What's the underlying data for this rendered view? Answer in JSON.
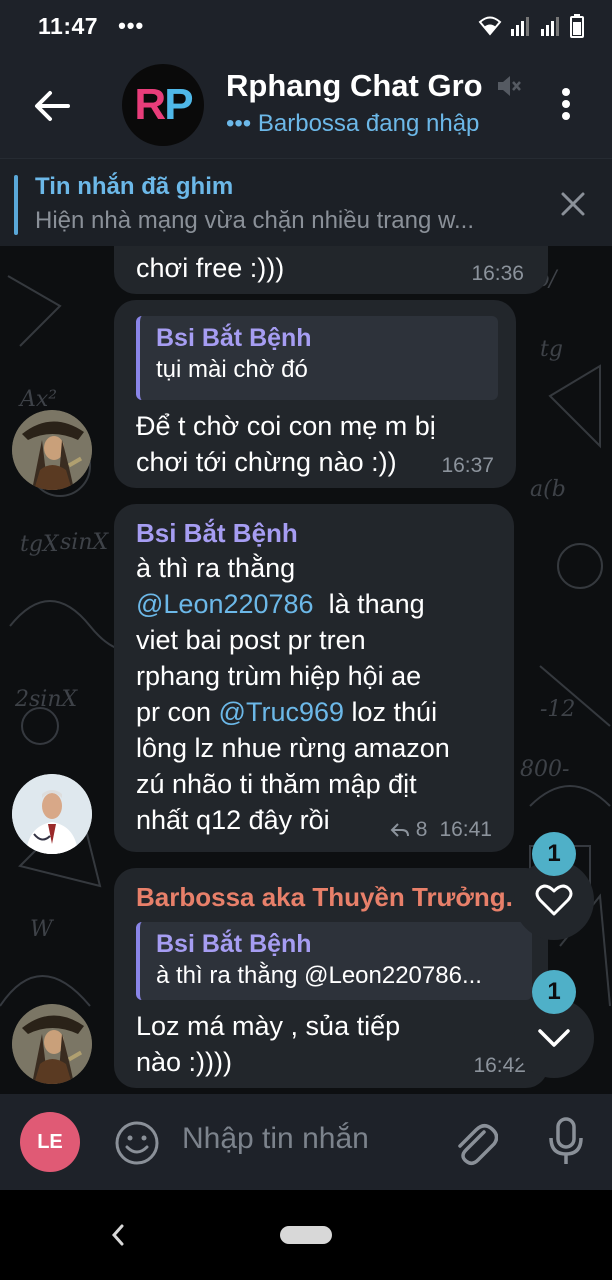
{
  "status_bar": {
    "time": "11:47",
    "dots": "•••"
  },
  "header": {
    "back_icon": "arrow-left-icon",
    "avatar_letters_1": "R",
    "avatar_letters_2": "P",
    "title": "Rphang Chat Gro",
    "status": "••• Barbossa đang nhập",
    "mute_icon": "muted-speaker-icon",
    "menu_icon": "more-vertical-icon"
  },
  "pinned": {
    "title": "Tin nhắn đã ghim",
    "text": "Hiện nhà mạng vừa chặn nhiều trang w...",
    "close_icon": "close-icon"
  },
  "messages": [
    {
      "text": "chơi free :)))",
      "time": "16:36"
    },
    {
      "quote_name": "Bsi Bắt Bệnh",
      "quote_text": "tụi mài chờ đó",
      "text_line1": "Để t chờ coi con mẹ m bị",
      "text_line2": "chơi tới chừng nào :))",
      "time": "16:37"
    },
    {
      "sender": "Bsi Bắt Bệnh",
      "line1": "à thì ra thằng",
      "mention1": "@Leon220786",
      "line2_rest": "  là thang",
      "line3": "viet bai post pr tren",
      "line4": "rphang trùm hiệp hội ae",
      "line5_pre": "pr con ",
      "mention2": "@Truc969",
      "line5_rest": " loz thúi",
      "line6": "lông lz nhue rừng amazon",
      "line7": "zú nhão ti thăm mập địt",
      "line8": "nhất q12 đây rồi",
      "reply_count": "8",
      "time": "16:41"
    },
    {
      "sender": "Barbossa aka Thuyền Trưởng...",
      "quote_name": "Bsi Bắt Bệnh",
      "quote_text": "à thì ra thằng @Leon220786...",
      "text_line1": "Loz má mày , sủa tiếp",
      "text_line2": "nào :))))",
      "time": "16:42"
    }
  ],
  "fabs": {
    "reaction_count": "1",
    "reaction_icon": "heart-icon",
    "scroll_count": "1",
    "scroll_icon": "chevron-down-icon"
  },
  "composer": {
    "avatar_initials": "LE",
    "placeholder": "Nhập tin nhắn",
    "emoji_icon": "smiley-icon",
    "attach_icon": "paperclip-icon",
    "mic_icon": "microphone-icon"
  },
  "colors": {
    "accent": "#6cb8e8",
    "sender_purple": "#a69df2",
    "sender_orange": "#e8806a",
    "bubble": "#22262b",
    "bar": "#1e2229"
  }
}
